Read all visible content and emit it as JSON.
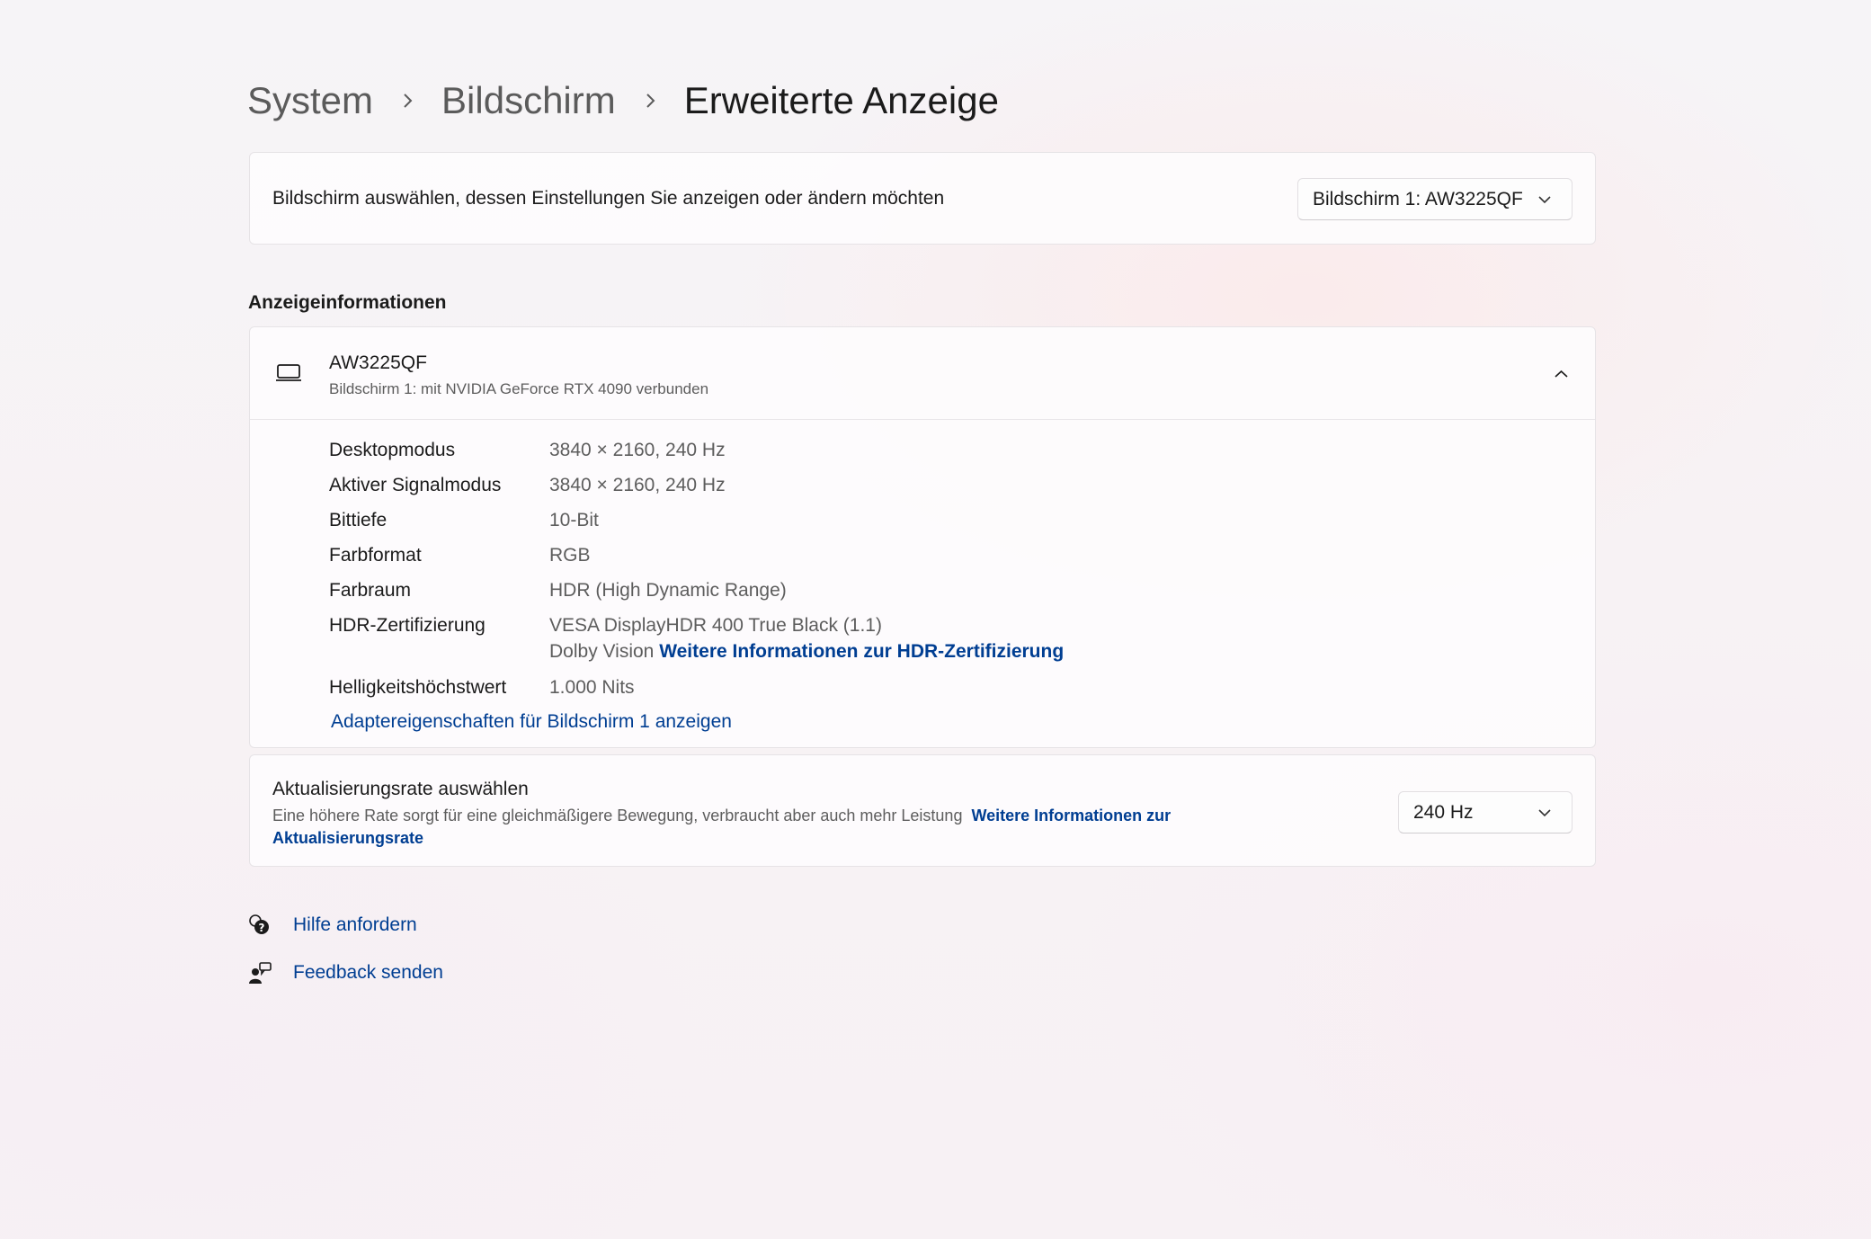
{
  "breadcrumb": {
    "items": [
      "System",
      "Bildschirm"
    ],
    "current": "Erweiterte Anzeige"
  },
  "display_select": {
    "label": "Bildschirm auswählen, dessen Einstellungen Sie anzeigen oder ändern möchten",
    "selected": "Bildschirm 1: AW3225QF"
  },
  "display_info": {
    "heading": "Anzeigeinformationen",
    "title": "AW3225QF",
    "subtitle": "Bildschirm 1: mit NVIDIA GeForce RTX 4090 verbunden",
    "rows": [
      {
        "key": "Desktopmodus",
        "value": "3840 × 2160, 240 Hz"
      },
      {
        "key": "Aktiver Signalmodus",
        "value": "3840 × 2160, 240 Hz"
      },
      {
        "key": "Bittiefe",
        "value": "10-Bit"
      },
      {
        "key": "Farbformat",
        "value": "RGB"
      },
      {
        "key": "Farbraum",
        "value": "HDR (High Dynamic Range)"
      }
    ],
    "hdr": {
      "key": "HDR-Zertifizierung",
      "value1": "VESA DisplayHDR 400 True Black (1.1)",
      "value2": "Dolby Vision",
      "link": "Weitere Informationen zur HDR-Zertifizierung"
    },
    "brightness": {
      "key": "Helligkeitshöchstwert",
      "value": "1.000 Nits"
    },
    "adapter_link": "Adaptereigenschaften für Bildschirm 1 anzeigen"
  },
  "refresh_rate": {
    "title": "Aktualisierungsrate auswählen",
    "description": "Eine höhere Rate sorgt für eine gleichmäßigere Bewegung, verbraucht aber auch mehr Leistung",
    "link": "Weitere Informationen zur Aktualisierungsrate",
    "selected": "240 Hz"
  },
  "footer": {
    "help": "Hilfe anfordern",
    "feedback": "Feedback senden"
  },
  "colors": {
    "link": "#003e92",
    "text_primary": "#1b1b1b",
    "text_secondary": "#5d5d5d"
  },
  "icons": {
    "breadcrumb_separator": "chevron-right-icon",
    "dropdown": "chevron-down-icon",
    "display": "laptop-icon",
    "collapse": "chevron-up-icon",
    "help": "help-chat-icon",
    "feedback": "feedback-icon"
  }
}
